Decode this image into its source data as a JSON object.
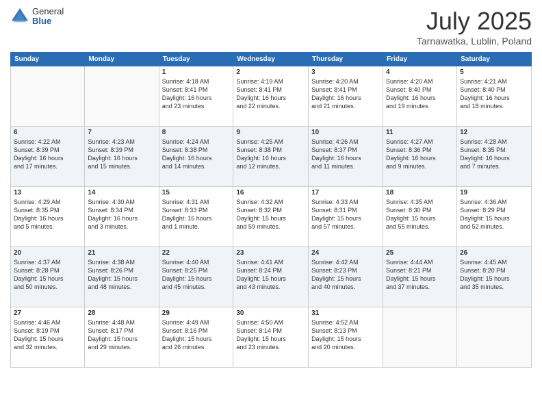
{
  "header": {
    "logo": {
      "general": "General",
      "blue": "Blue"
    },
    "title": "July 2025",
    "location": "Tarnawatka, Lublin, Poland"
  },
  "days_of_week": [
    "Sunday",
    "Monday",
    "Tuesday",
    "Wednesday",
    "Thursday",
    "Friday",
    "Saturday"
  ],
  "weeks": [
    [
      {
        "num": "",
        "info": ""
      },
      {
        "num": "",
        "info": ""
      },
      {
        "num": "1",
        "info": "Sunrise: 4:18 AM\nSunset: 8:41 PM\nDaylight: 16 hours\nand 23 minutes."
      },
      {
        "num": "2",
        "info": "Sunrise: 4:19 AM\nSunset: 8:41 PM\nDaylight: 16 hours\nand 22 minutes."
      },
      {
        "num": "3",
        "info": "Sunrise: 4:20 AM\nSunset: 8:41 PM\nDaylight: 16 hours\nand 21 minutes."
      },
      {
        "num": "4",
        "info": "Sunrise: 4:20 AM\nSunset: 8:40 PM\nDaylight: 16 hours\nand 19 minutes."
      },
      {
        "num": "5",
        "info": "Sunrise: 4:21 AM\nSunset: 8:40 PM\nDaylight: 16 hours\nand 18 minutes."
      }
    ],
    [
      {
        "num": "6",
        "info": "Sunrise: 4:22 AM\nSunset: 8:39 PM\nDaylight: 16 hours\nand 17 minutes."
      },
      {
        "num": "7",
        "info": "Sunrise: 4:23 AM\nSunset: 8:39 PM\nDaylight: 16 hours\nand 15 minutes."
      },
      {
        "num": "8",
        "info": "Sunrise: 4:24 AM\nSunset: 8:38 PM\nDaylight: 16 hours\nand 14 minutes."
      },
      {
        "num": "9",
        "info": "Sunrise: 4:25 AM\nSunset: 8:38 PM\nDaylight: 16 hours\nand 12 minutes."
      },
      {
        "num": "10",
        "info": "Sunrise: 4:26 AM\nSunset: 8:37 PM\nDaylight: 16 hours\nand 11 minutes."
      },
      {
        "num": "11",
        "info": "Sunrise: 4:27 AM\nSunset: 8:36 PM\nDaylight: 16 hours\nand 9 minutes."
      },
      {
        "num": "12",
        "info": "Sunrise: 4:28 AM\nSunset: 8:35 PM\nDaylight: 16 hours\nand 7 minutes."
      }
    ],
    [
      {
        "num": "13",
        "info": "Sunrise: 4:29 AM\nSunset: 8:35 PM\nDaylight: 16 hours\nand 5 minutes."
      },
      {
        "num": "14",
        "info": "Sunrise: 4:30 AM\nSunset: 8:34 PM\nDaylight: 16 hours\nand 3 minutes."
      },
      {
        "num": "15",
        "info": "Sunrise: 4:31 AM\nSunset: 8:33 PM\nDaylight: 16 hours\nand 1 minute."
      },
      {
        "num": "16",
        "info": "Sunrise: 4:32 AM\nSunset: 8:32 PM\nDaylight: 15 hours\nand 59 minutes."
      },
      {
        "num": "17",
        "info": "Sunrise: 4:33 AM\nSunset: 8:31 PM\nDaylight: 15 hours\nand 57 minutes."
      },
      {
        "num": "18",
        "info": "Sunrise: 4:35 AM\nSunset: 8:30 PM\nDaylight: 15 hours\nand 55 minutes."
      },
      {
        "num": "19",
        "info": "Sunrise: 4:36 AM\nSunset: 8:29 PM\nDaylight: 15 hours\nand 52 minutes."
      }
    ],
    [
      {
        "num": "20",
        "info": "Sunrise: 4:37 AM\nSunset: 8:28 PM\nDaylight: 15 hours\nand 50 minutes."
      },
      {
        "num": "21",
        "info": "Sunrise: 4:38 AM\nSunset: 8:26 PM\nDaylight: 15 hours\nand 48 minutes."
      },
      {
        "num": "22",
        "info": "Sunrise: 4:40 AM\nSunset: 8:25 PM\nDaylight: 15 hours\nand 45 minutes."
      },
      {
        "num": "23",
        "info": "Sunrise: 4:41 AM\nSunset: 8:24 PM\nDaylight: 15 hours\nand 43 minutes."
      },
      {
        "num": "24",
        "info": "Sunrise: 4:42 AM\nSunset: 8:23 PM\nDaylight: 15 hours\nand 40 minutes."
      },
      {
        "num": "25",
        "info": "Sunrise: 4:44 AM\nSunset: 8:21 PM\nDaylight: 15 hours\nand 37 minutes."
      },
      {
        "num": "26",
        "info": "Sunrise: 4:45 AM\nSunset: 8:20 PM\nDaylight: 15 hours\nand 35 minutes."
      }
    ],
    [
      {
        "num": "27",
        "info": "Sunrise: 4:46 AM\nSunset: 8:19 PM\nDaylight: 15 hours\nand 32 minutes."
      },
      {
        "num": "28",
        "info": "Sunrise: 4:48 AM\nSunset: 8:17 PM\nDaylight: 15 hours\nand 29 minutes."
      },
      {
        "num": "29",
        "info": "Sunrise: 4:49 AM\nSunset: 8:16 PM\nDaylight: 15 hours\nand 26 minutes."
      },
      {
        "num": "30",
        "info": "Sunrise: 4:50 AM\nSunset: 8:14 PM\nDaylight: 15 hours\nand 23 minutes."
      },
      {
        "num": "31",
        "info": "Sunrise: 4:52 AM\nSunset: 8:13 PM\nDaylight: 15 hours\nand 20 minutes."
      },
      {
        "num": "",
        "info": ""
      },
      {
        "num": "",
        "info": ""
      }
    ]
  ]
}
